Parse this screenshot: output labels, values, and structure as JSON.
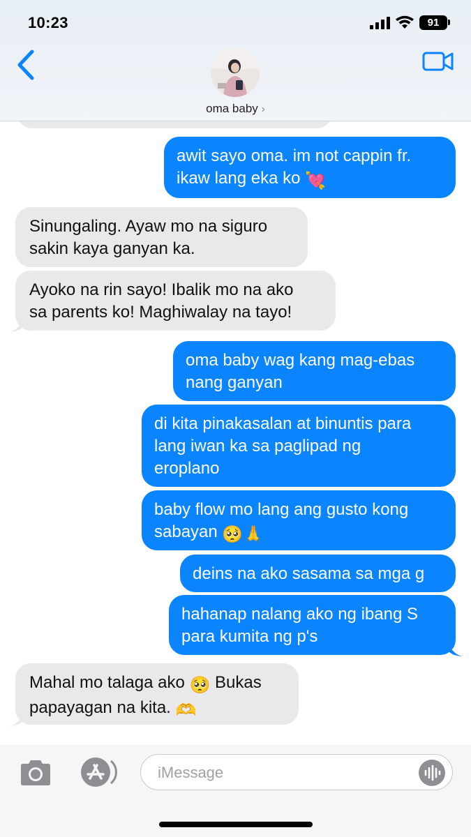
{
  "status_bar": {
    "time": "10:23",
    "battery": "91"
  },
  "header": {
    "contact_name": "oma baby",
    "chevron": "›"
  },
  "messages": [
    {
      "direction": "out",
      "lines": [
        "awit sayo oma. im not cappin fr.",
        "ikaw lang eka ko"
      ],
      "emoji": "💘"
    },
    {
      "direction": "in",
      "lines": [
        "Sinungaling. Ayaw mo na siguro",
        "sakin kaya ganyan ka."
      ]
    },
    {
      "direction": "in",
      "lines": [
        "Ayoko na rin sayo! Ibalik mo na ako",
        "sa parents ko! Maghiwalay na tayo!"
      ]
    },
    {
      "direction": "out",
      "lines": [
        "oma baby wag kang mag-ebas",
        "nang ganyan"
      ]
    },
    {
      "direction": "out",
      "lines": [
        "di kita pinakasalan at binuntis para",
        "lang iwan ka sa paglipad ng",
        "eroplano"
      ]
    },
    {
      "direction": "out",
      "lines": [
        "baby flow mo lang ang gusto kong",
        "sabayan"
      ],
      "emoji": "🥺🙏"
    },
    {
      "direction": "out",
      "lines": [
        "deins na ako sasama sa mga g"
      ]
    },
    {
      "direction": "out",
      "lines": [
        "hahanap nalang ako ng ibang S",
        "para kumita ng p's"
      ]
    },
    {
      "direction": "in",
      "lines": [
        "Mahal mo talaga ako",
        "papayagan na kita."
      ],
      "inline_emoji": "🥺",
      "line1_suffix": "Bukas",
      "emoji": "🫶"
    }
  ],
  "input": {
    "placeholder": "iMessage"
  },
  "icons": {
    "back": "chevron-left-icon",
    "video": "video-camera-icon",
    "camera": "camera-icon",
    "apps": "app-store-icon",
    "audio": "audio-waveform-icon"
  },
  "colors": {
    "accent": "#0a84ff",
    "incoming": "#e9e9eb",
    "text_outgoing": "#ffffff"
  }
}
